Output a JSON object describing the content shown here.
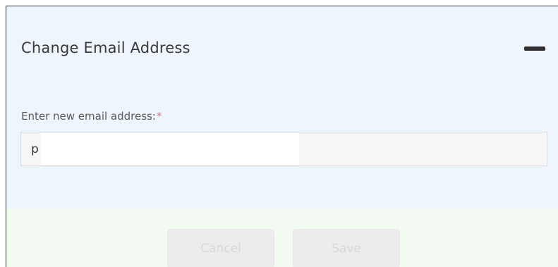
{
  "panel": {
    "title": "Change Email Address",
    "collapse_icon": "minus-icon"
  },
  "form": {
    "email_label": "Enter new email address:",
    "required_marker": "*",
    "email_value": "p",
    "email_value_redacted": true
  },
  "footer": {
    "cancel_label": "Cancel",
    "save_label": "Save",
    "buttons_disabled": true
  },
  "colors": {
    "panel_background": "#eef5fc",
    "footer_background": "#f3faf1",
    "required_marker": "#e06b7a"
  }
}
